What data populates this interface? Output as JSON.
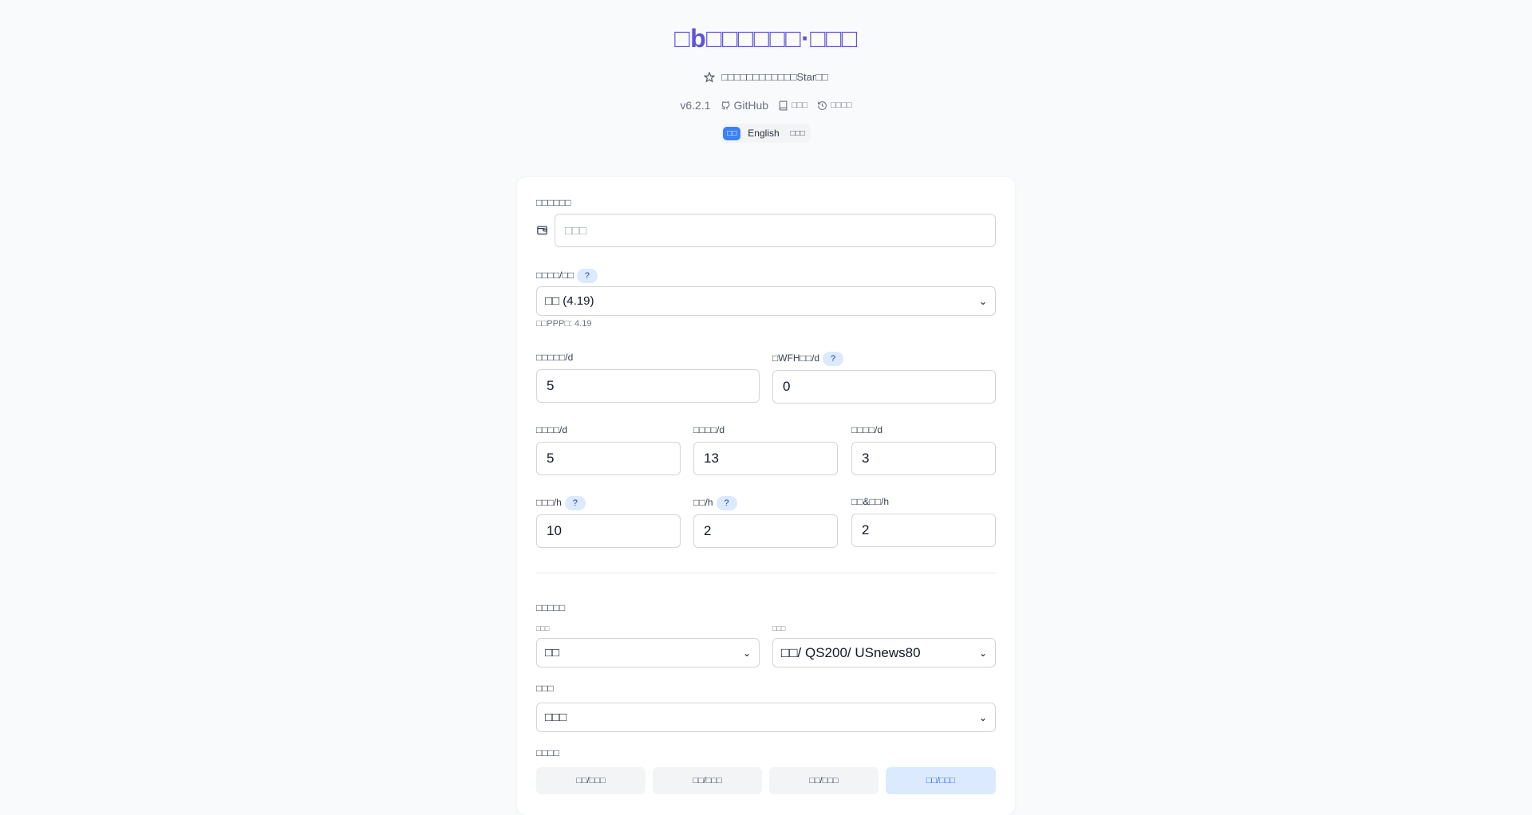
{
  "header": {
    "title": "□b□□□□□□·□□□",
    "subtitle": "□□□□□□□□□□□□Star□□",
    "version": "v6.2.1",
    "github": "GitHub",
    "docs": "□□□",
    "history": "□□□□"
  },
  "lang": {
    "zh": "□□",
    "en": "English",
    "other": "□□□"
  },
  "form": {
    "salary": {
      "label": "□□□□□□",
      "placeholder": "□□□"
    },
    "country": {
      "label": "□□□□/□□",
      "selected": "□□ (4.19)",
      "hint": "□□PPP□: 4.19"
    },
    "workdays": {
      "label": "□□□□□/d",
      "value": "5"
    },
    "wfh": {
      "label": "□WFH□□/d",
      "value": "0"
    },
    "annual": {
      "label": "□□□□/d",
      "value": "5"
    },
    "holiday": {
      "label": "□□□□/d",
      "value": "13"
    },
    "sick": {
      "label": "□□□□/d",
      "value": "3"
    },
    "worktime": {
      "label": "□□□/h",
      "value": "10"
    },
    "commute": {
      "label": "□□/h",
      "value": "2"
    },
    "rest": {
      "label": "□□&□□/h",
      "value": "2"
    },
    "education": {
      "section": "□□□□□",
      "degree_label": "□□□",
      "degree_value": "□□",
      "school_label": "□□□",
      "school_value": "□□/ QS200/ USnews80"
    },
    "env": {
      "label": "□□□",
      "value": "□□□"
    },
    "city": {
      "label": "□□□□",
      "tabs": [
        "□□/□□□",
        "□□/□□□",
        "□□/□□□",
        "□□/□□□"
      ],
      "active_index": 3
    }
  }
}
